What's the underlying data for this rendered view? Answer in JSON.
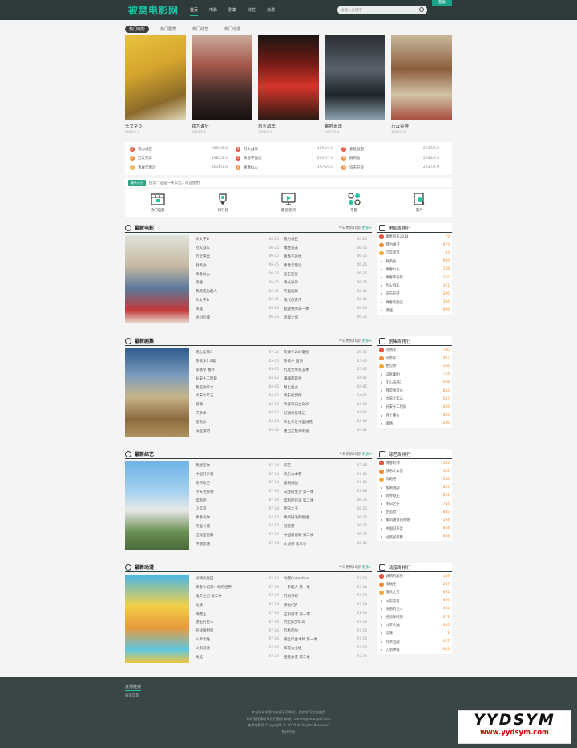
{
  "header": {
    "logo": "被窝电影网",
    "nav": [
      "首页",
      "电影",
      "剧集",
      "综艺",
      "动漫"
    ],
    "search_placeholder": "请输入关键字",
    "login": "登录"
  },
  "hot": {
    "tabs": [
      "热门电影",
      "热门剧集",
      "热门综艺",
      "热门动漫"
    ],
    "posters": [
      {
        "title": "头文字D",
        "sub": "2005/6.0"
      },
      {
        "title": "我为谁狂",
        "sub": "2004/6.0"
      },
      {
        "title": "烈火战车",
        "sub": "1995/3.0"
      },
      {
        "title": "乘胜追击",
        "sub": "2017/2.0"
      },
      {
        "title": "万云突奔",
        "sub": "1985/2.0"
      }
    ]
  },
  "rank": [
    [
      {
        "n": "1",
        "name": "我为谁狂",
        "val": "2004/6.0"
      },
      {
        "n": "2",
        "name": "万云突奔",
        "val": "1985/2.0"
      },
      {
        "n": "3",
        "name": "青春无限远",
        "val": "2016/3.0"
      }
    ],
    [
      {
        "n": "4",
        "name": "烈火战车",
        "val": "1995/3.0"
      },
      {
        "n": "5",
        "name": "青春不设忧",
        "val": "2017/7.0"
      },
      {
        "n": "6",
        "name": "青春似火",
        "val": "1976/5.0"
      }
    ],
    [
      {
        "n": "7",
        "name": "乘胜追击",
        "val": "2017/2.0"
      },
      {
        "n": "8",
        "name": "群英会",
        "val": "2000/6.0"
      },
      {
        "n": "9",
        "name": "追击狂徒",
        "val": "2017/2.0"
      }
    ]
  ],
  "notice": {
    "tag": "最新公告",
    "text": "提示：这是一条公告，欢迎使用"
  },
  "quick": [
    "热门电影",
    "排行榜",
    "最近更新",
    "专题",
    "求片"
  ],
  "sections": [
    {
      "title": "最新电影",
      "meta": "今日更新10部",
      "more": "更多>",
      "col1": [
        [
          "头文字D",
          "06-25"
        ],
        [
          "烈火战车",
          "06-25"
        ],
        [
          "万云突奔",
          "06-25"
        ],
        [
          "群英会",
          "06-25"
        ],
        [
          "青春似火",
          "06-25"
        ],
        [
          "情迷",
          "06-25"
        ],
        [
          "我要成为超人",
          "06-25"
        ],
        [
          "头文字D",
          "06-25"
        ],
        [
          "英雄",
          "06-25"
        ],
        [
          "冰封的城",
          "06-25"
        ]
      ],
      "col2": [
        [
          "我为谁狂",
          "06-25"
        ],
        [
          "乘胜追击",
          "06-25"
        ],
        [
          "青春不设忧",
          "06-25"
        ],
        [
          "青春无限远",
          "06-25"
        ],
        [
          "追击狂徒",
          "06-25"
        ],
        [
          "情长岁月",
          "06-25"
        ],
        [
          "万里追踪",
          "06-25"
        ],
        [
          "现代侠客传",
          "06-25"
        ],
        [
          "超能特务第一季",
          "06-25"
        ],
        [
          "流浪之城",
          "06-25"
        ]
      ]
    },
    {
      "title": "最新剧集",
      "meta": "今日更新10部",
      "more": "更多>",
      "col1": [
        [
          "无心法师3",
          "07-24"
        ],
        [
          "陈情令2.0版",
          "05-05"
        ],
        [
          "陈情令 番外",
          "05-05"
        ],
        [
          "长安十二时辰",
          "04-02"
        ],
        [
          "我是余欢水",
          "04-02"
        ],
        [
          "大宋少年志",
          "04-02"
        ],
        [
          "爱情",
          "04-02"
        ],
        [
          "庆余年",
          "04-02"
        ],
        [
          "想见你",
          "04-02"
        ],
        [
          "法医秦明",
          "04-02"
        ]
      ],
      "col2": [
        [
          "陈情令2.0 电视",
          "05-05"
        ],
        [
          "陈情令 国语",
          "05-05"
        ],
        [
          "九龙皇帝第五季",
          "05-05"
        ],
        [
          "满城都是你",
          "04-02"
        ],
        [
          "月上重火",
          "04-02"
        ],
        [
          "终于找到你",
          "04-02"
        ],
        [
          "终极笔记之DVD",
          "04-02"
        ],
        [
          "幻想终极笔记",
          "04-02"
        ],
        [
          "三生三世十里桃花",
          "04-02"
        ],
        [
          "重启之极海听雷",
          "04-02"
        ]
      ]
    },
    {
      "title": "最新综艺",
      "meta": "今日更新10部",
      "more": "更多>",
      "col1": [
        [
          "我想见你",
          "07-14"
        ],
        [
          "中国好声音",
          "07-14"
        ],
        [
          "跨界歌王",
          "07-14"
        ],
        [
          "今天也很帅",
          "07-14"
        ],
        [
          "奔跑吧",
          "07-14"
        ],
        [
          "少年说",
          "07-14"
        ],
        [
          "青春有你",
          "07-14"
        ],
        [
          "万里长城",
          "07-14"
        ],
        [
          "这就是街舞",
          "07-14"
        ],
        [
          "不期而遇",
          "07-14"
        ]
      ],
      "col2": [
        [
          "综艺",
          "07-08"
        ],
        [
          "快乐大本营",
          "07-08"
        ],
        [
          "极限挑战",
          "07-08"
        ],
        [
          "向往的生活 第一季",
          "07-08"
        ],
        [
          "奔跑吧兄弟 第二季",
          "06-25"
        ],
        [
          "明日之子",
          "06-25"
        ],
        [
          "乘风破浪的姐姐",
          "06-25"
        ],
        [
          "创造营",
          "06-25"
        ],
        [
          "中国新说唱 第二季",
          "06-25"
        ],
        [
          "大侦探 第三季",
          "06-25"
        ]
      ]
    },
    {
      "title": "最新动漫",
      "meta": "今日更新10部",
      "more": "更多>",
      "col1": [
        [
          "妖精的尾巴",
          "07-14"
        ],
        [
          "青春小说家：你的世界",
          "07-14"
        ],
        [
          "鬼灭之刃 第三季",
          "07-14"
        ],
        [
          "龙珠",
          "07-14"
        ],
        [
          "海贼王",
          "07-14"
        ],
        [
          "进击的巨人",
          "07-14"
        ],
        [
          "名侦探柯南",
          "07-14"
        ],
        [
          "斗罗大陆",
          "07-14"
        ],
        [
          "火影忍者",
          "07-14"
        ],
        [
          "灵笼",
          "07-14"
        ]
      ],
      "col2": [
        [
          "动漫Collection",
          "07-14"
        ],
        [
          "一拳超人 第一季",
          "07-14"
        ],
        [
          "刀剑神域",
          "07-14"
        ],
        [
          "哆啦A梦",
          "07-14"
        ],
        [
          "全职高手 第二季",
          "07-14"
        ],
        [
          "约定的梦幻岛",
          "07-14"
        ],
        [
          "咒术回战",
          "07-14"
        ],
        [
          "钢之炼金术师 第一季",
          "07-14"
        ],
        [
          "辉夜大小姐",
          "07-14"
        ],
        [
          "租借女友 第二季",
          "07-14"
        ]
      ]
    }
  ],
  "side": [
    {
      "title": "电影周排行",
      "items": [
        [
          "乘胜追击2014",
          "72"
        ],
        [
          "我为谁狂",
          "473"
        ],
        [
          "万云突奔",
          "43"
        ],
        [
          "群英会",
          "649"
        ],
        [
          "青春似火",
          "168"
        ],
        [
          "青春不设忧",
          "355"
        ],
        [
          "烈火战车",
          "201"
        ],
        [
          "追击狂徒",
          "206"
        ],
        [
          "青春无限远",
          "394"
        ],
        [
          "情迷",
          "909"
        ]
      ]
    },
    {
      "title": "剧集周排行",
      "items": [
        [
          "陈情令",
          "780"
        ],
        [
          "庆余年",
          "407"
        ],
        [
          "想见你",
          "356"
        ],
        [
          "法医秦明",
          "724"
        ],
        [
          "无心法师3",
          "658"
        ],
        [
          "我是余欢水",
          "842"
        ],
        [
          "大宋少年志",
          "547"
        ],
        [
          "长安十二时辰",
          "459"
        ],
        [
          "月上重火",
          "485"
        ],
        [
          "爱情",
          "286"
        ]
      ]
    },
    {
      "title": "综艺周排行",
      "items": [
        [
          "青春有你",
          "532"
        ],
        [
          "快乐大本营",
          "502"
        ],
        [
          "奔跑吧",
          "586"
        ],
        [
          "极限挑战",
          "867"
        ],
        [
          "跨界歌王",
          "651"
        ],
        [
          "明日之子",
          "744"
        ],
        [
          "创造营",
          "885"
        ],
        [
          "乘风破浪的姐姐",
          "234"
        ],
        [
          "中国好声音",
          "864"
        ],
        [
          "这就是街舞",
          "868"
        ]
      ]
    },
    {
      "title": "动漫周排行",
      "items": [
        [
          "妖精的尾巴",
          "549"
        ],
        [
          "海贼王",
          "267"
        ],
        [
          "鬼灭之刃",
          "661"
        ],
        [
          "火影忍者",
          "609"
        ],
        [
          "进击的巨人",
          "422"
        ],
        [
          "名侦探柯南",
          "271"
        ],
        [
          "斗罗大陆",
          "635"
        ],
        [
          "灵笼",
          "1"
        ],
        [
          "咒术回战",
          "627"
        ],
        [
          "刀剑神域",
          "603"
        ]
      ]
    }
  ],
  "footer": {
    "links_title": "友情链接",
    "link": "被窝电影",
    "lines": [
      "本站所有内容均来源于互联网，仅供学习交流使用",
      "如有侵权请联系我们删除 邮箱：admin@example.com",
      "被窝电影网 Copyright © 2020 All Rights Reserved",
      "统计代码"
    ]
  },
  "watermark": {
    "line1": "YYDSYM",
    "line2": "www.yydsym.com"
  },
  "colors": {
    "accent": "#19c4a3",
    "header": "#2f3b3b",
    "rank1": "#e8543d",
    "rank2": "#f08a30",
    "rank3": "#f4a93f"
  }
}
